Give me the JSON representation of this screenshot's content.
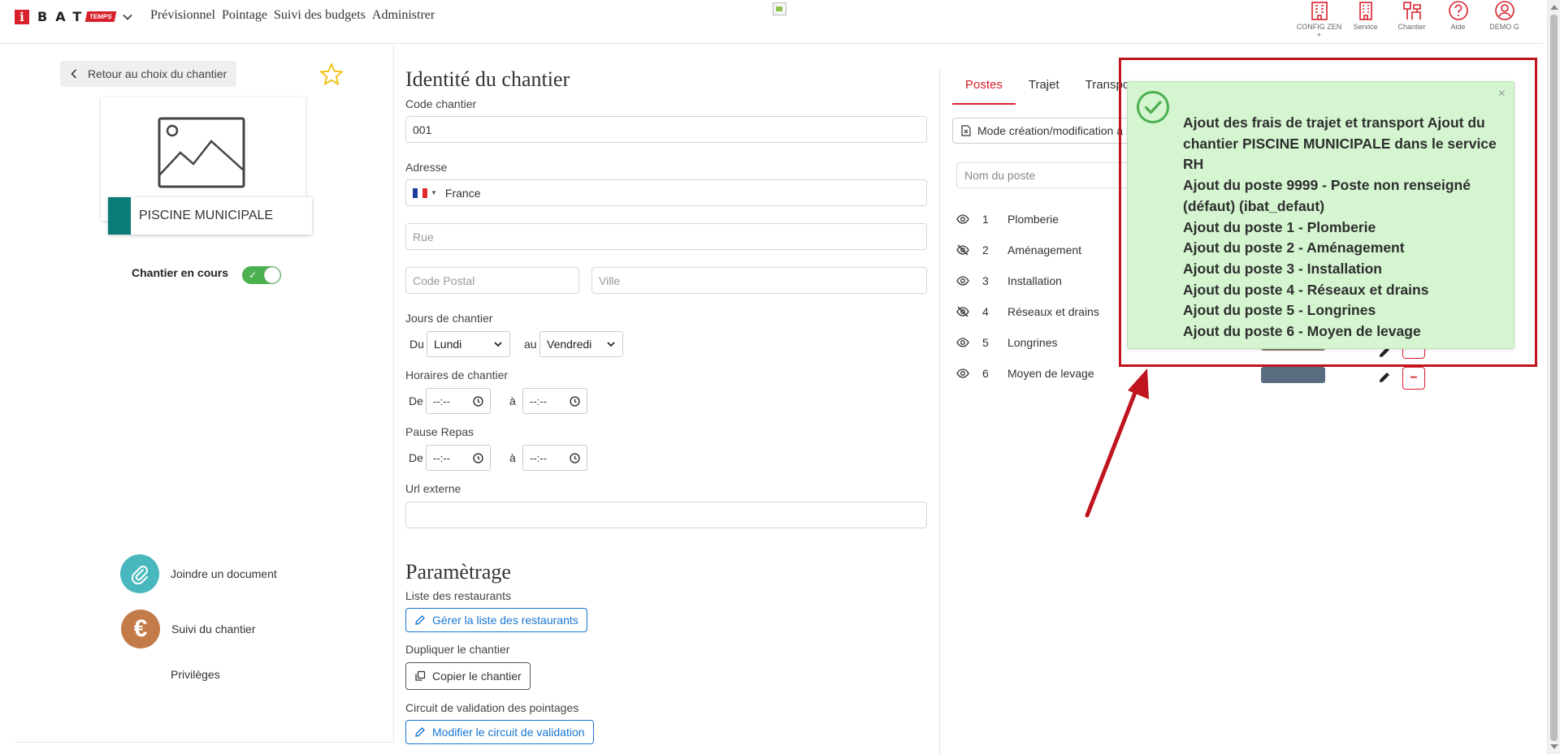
{
  "nav": {
    "logo_i": "i",
    "logo_bat": "BAT",
    "logo_temps": "TEMPS",
    "menu": [
      "Prévisionnel",
      "Pointage",
      "Suivi des budgets",
      "Administrer"
    ],
    "icons": [
      {
        "label": "CONFIG ZEN",
        "sub": "+",
        "icon": "building-icon"
      },
      {
        "label": "Service",
        "icon": "office-icon"
      },
      {
        "label": "Chantier",
        "icon": "construction-icon"
      },
      {
        "label": "Aide",
        "icon": "help-icon"
      },
      {
        "label": "DEMO G",
        "icon": "user-icon"
      }
    ]
  },
  "left": {
    "back": "Retour au choix du chantier",
    "site_name": "PISCINE MUNICIPALE",
    "status_label": "Chantier en cours",
    "status_on": true,
    "actions": {
      "document": "Joindre un document",
      "suivi": "Suivi du chantier",
      "suivi_symbol": "€",
      "privileges": "Privilèges"
    }
  },
  "form": {
    "title": "Identité du chantier",
    "code_label": "Code chantier",
    "code_value": "001",
    "address_label": "Adresse",
    "country": "France",
    "rue_ph": "Rue",
    "cp_ph": "Code Postal",
    "ville_ph": "Ville",
    "jours_label": "Jours de chantier",
    "du": "Du",
    "au": "au",
    "jour_debut": "Lundi",
    "jour_fin": "Vendredi",
    "horaires_label": "Horaires de chantier",
    "pause_label": "Pause Repas",
    "de": "De",
    "a": "à",
    "time_empty": "--:--",
    "url_label": "Url externe",
    "param_title": "Paramètrage",
    "restaurants_label": "Liste des restaurants",
    "restaurants_btn": "Gérer la liste des restaurants",
    "dupliquer_label": "Dupliquer le chantier",
    "copier_btn": "Copier le chantier",
    "circuit_label": "Circuit de validation des pointages",
    "circuit_btn": "Modifier le circuit de validation"
  },
  "right": {
    "tabs": [
      "Postes",
      "Trajet",
      "Transpo"
    ],
    "active_tab": 0,
    "mode_btn": "Mode création/modification a",
    "poste_ph": "Nom du poste",
    "postes": [
      {
        "num": "1",
        "name": "Plomberie",
        "visible": true
      },
      {
        "num": "2",
        "name": "Aménagement",
        "visible": false
      },
      {
        "num": "3",
        "name": "Installation",
        "visible": true
      },
      {
        "num": "4",
        "name": "Réseaux et drains",
        "visible": false
      },
      {
        "num": "5",
        "name": "Longrines",
        "visible": true
      },
      {
        "num": "6",
        "name": "Moyen de levage",
        "visible": true
      }
    ]
  },
  "toast": {
    "close": "×",
    "lines": [
      "Ajout des frais de trajet et transport Ajout du chantier PISCINE MUNICIPALE dans le service RH",
      "Ajout du poste 9999 - Poste non renseigné (défaut) (ibat_defaut)",
      "Ajout du poste 1 - Plomberie",
      "Ajout du poste 2 - Aménagement",
      "Ajout du poste 3 - Installation",
      "Ajout du poste 4 - Réseaux et drains",
      "Ajout du poste 5 - Longrines",
      "Ajout du poste 6 - Moyen de levage"
    ],
    "success_color": "#4caf50",
    "highlight_color": "#c0141e"
  },
  "colors": {
    "brand_red": "#d8202c",
    "teal": "#0a7b77",
    "link_blue": "#1976d2"
  }
}
